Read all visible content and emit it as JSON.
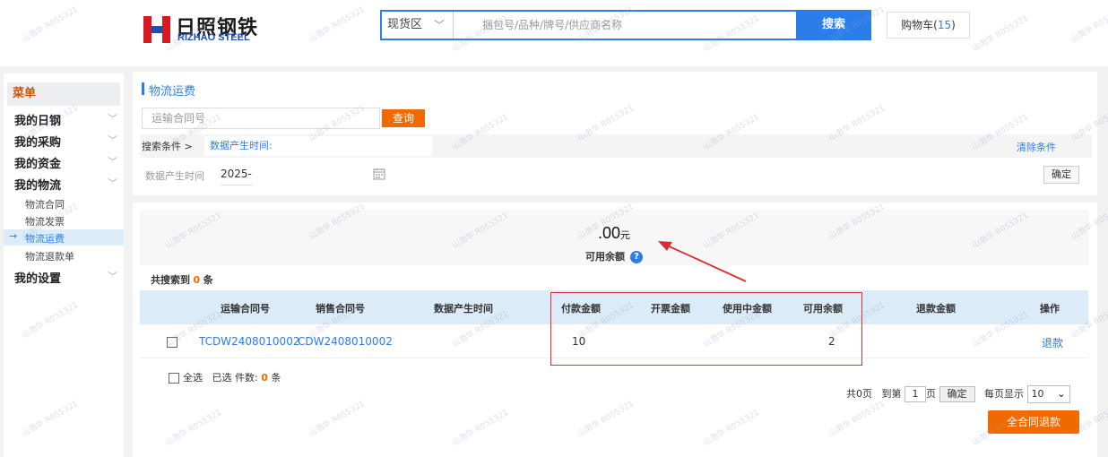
{
  "brand": {
    "name_cn": "日照钢铁",
    "name_en": "RIZHAO STEEL"
  },
  "search": {
    "area_label": "现货区",
    "placeholder": "捆包号/品种/牌号/供应商名称",
    "button_label": "搜索"
  },
  "cart": {
    "label": "购物车(",
    "count": "15",
    "suffix": ")"
  },
  "sidebar": {
    "title": "菜单",
    "items": [
      {
        "label": "我的日钢"
      },
      {
        "label": "我的采购"
      },
      {
        "label": "我的资金"
      },
      {
        "label": "我的物流"
      },
      {
        "label": "我的设置"
      }
    ],
    "subitems": [
      {
        "label": "物流合同"
      },
      {
        "label": "物流发票"
      },
      {
        "label": "物流运费"
      },
      {
        "label": "物流退款单"
      }
    ]
  },
  "filter": {
    "section_title": "物流运费",
    "contract_placeholder": "运输合同号",
    "query_button": "查询",
    "conditions_label": "搜索条件 >",
    "conditions_value": "数据产生时间:",
    "clear_label": "清除条件",
    "date_label": "数据产生时间",
    "date_value": "2025-",
    "confirm_label": "确定"
  },
  "balance": {
    "amount": ".00",
    "unit": "元",
    "label": "可用余额"
  },
  "results": {
    "prefix": "共搜索到",
    "count": "0",
    "suffix": "条"
  },
  "table": {
    "headers": [
      "运输合同号",
      "销售合同号",
      "数据产生时间",
      "付款金额",
      "开票金额",
      "使用中金额",
      "可用余额",
      "退款金额",
      "操作"
    ],
    "rows": [
      {
        "transport_no": "TCDW2408010002",
        "sales_no": "CDW2408010002",
        "time": "",
        "paid": "10",
        "invoiced": "",
        "in_use": "",
        "available": "2",
        "refund": "",
        "action": "退款"
      }
    ]
  },
  "footer": {
    "select_all": "全选",
    "selected_label": "已选 件数:",
    "selected_count": "0",
    "selected_suffix": "条",
    "total_pages": "共0页",
    "goto_prefix": "到第",
    "goto_page": "1",
    "goto_suffix": "页",
    "goto_button": "确定",
    "per_page_label": "每页显示",
    "per_page_value": "10",
    "refund_all_button": "全合同退款"
  },
  "watermark": {
    "text": "山渤华 R055321"
  },
  "colors": {
    "accent": "#2b7de9",
    "orange": "#f06a00",
    "annotation_red": "#d63031"
  }
}
